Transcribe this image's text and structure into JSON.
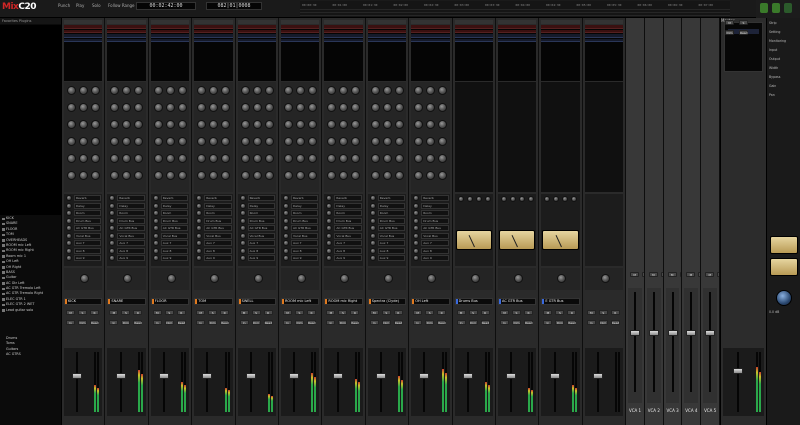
{
  "app": {
    "logo_prefix": "Mix",
    "logo_suffix": "C20",
    "toolbar": [
      "Punch",
      "Play",
      "Solo",
      "Follow Range"
    ],
    "clock": "00:02:42:00",
    "bars": "082|01|0008"
  },
  "timeline": {
    "ticks": [
      "00:00:30",
      "00:01:00",
      "00:01:30",
      "00:02:00",
      "00:02:30",
      "00:03:00",
      "00:03:30",
      "00:04:00",
      "00:04:30",
      "00:05:00",
      "00:05:30",
      "00:06:00",
      "00:06:30",
      "00:07:00"
    ]
  },
  "sidebar": {
    "header": "Favorites Plugins",
    "tracks_header": "Tracks",
    "tracks": [
      "KICK",
      "SNARE",
      "FLOOR",
      "TOM",
      "OVERHEADS",
      "ROOM mic Left",
      "ROOM mic Right",
      "Room mic 1",
      "OH Left",
      "OH Right",
      "BASS",
      "Guitar",
      "AC Gtr Left",
      "AC GTR Tremolo Left",
      "AC GTR Tremolo Right",
      "ELEC GTR 1",
      "ELEC GTR 2 WET",
      "Lead guitar solo"
    ],
    "groups_header": "Groups",
    "groups": [
      "Drums",
      "Toms",
      "Guitars",
      "AC GTRS"
    ]
  },
  "channels": [
    {
      "name": "KICK",
      "color": "orange",
      "fader": 0.62,
      "meter": 0.45
    },
    {
      "name": "SNARE",
      "color": "orange",
      "fader": 0.62,
      "meter": 0.7
    },
    {
      "name": "FLOOR",
      "color": "orange",
      "fader": 0.62,
      "meter": 0.5
    },
    {
      "name": "TOM",
      "color": "orange",
      "fader": 0.62,
      "meter": 0.4
    },
    {
      "name": "SWELL",
      "color": "orange",
      "fader": 0.62,
      "meter": 0.3
    },
    {
      "name": "ROOM mic Left",
      "color": "orange",
      "fader": 0.62,
      "meter": 0.65
    },
    {
      "name": "ROOM mic Right",
      "color": "orange",
      "fader": 0.62,
      "meter": 0.55
    },
    {
      "name": "Spectra (Clyde)",
      "color": "orange",
      "fader": 0.62,
      "meter": 0.6
    },
    {
      "name": "OH Left",
      "color": "orange",
      "fader": 0.62,
      "meter": 0.72
    },
    {
      "name": "Drums Bus",
      "color": "blue",
      "fader": 0.62,
      "meter": 0.5
    },
    {
      "name": "AC GTR Bus",
      "color": "blue",
      "fader": 0.62,
      "meter": 0.4
    },
    {
      "name": "E GTR Bus",
      "color": "blue",
      "fader": 0.62,
      "meter": 0.45
    },
    {
      "name": "",
      "color": "none",
      "fader": 0.62,
      "meter": 0.0
    }
  ],
  "vcas": [
    "VCA 1",
    "VCA 2",
    "VCA 3",
    "VCA 4",
    "VCA 5"
  ],
  "sends": [
    "Reverb",
    "Delay",
    "Room",
    "Drum Bus",
    "AC GTR Bus",
    "Vocal Bus",
    "Aux 7",
    "Aux 8",
    "Aux 9"
  ],
  "button_labels": {
    "mute": "M",
    "solo": "S",
    "rec": "R",
    "input": "In",
    "dim": "Dim",
    "auto": "Read"
  },
  "master": {
    "name": "Master",
    "tag": "MSTR",
    "fader": 0.72,
    "meter": 0.75
  },
  "inspector": {
    "title": "Strip",
    "labels": [
      "Setting",
      "Monitoring",
      "Input",
      "Output",
      "Width",
      "Bypass",
      "Gain",
      "Pan"
    ],
    "value": "0.0 dB"
  },
  "colors": {
    "accent_orange": "#e07a1f",
    "accent_blue": "#3a6adf",
    "insert_red": "#3a1010"
  }
}
